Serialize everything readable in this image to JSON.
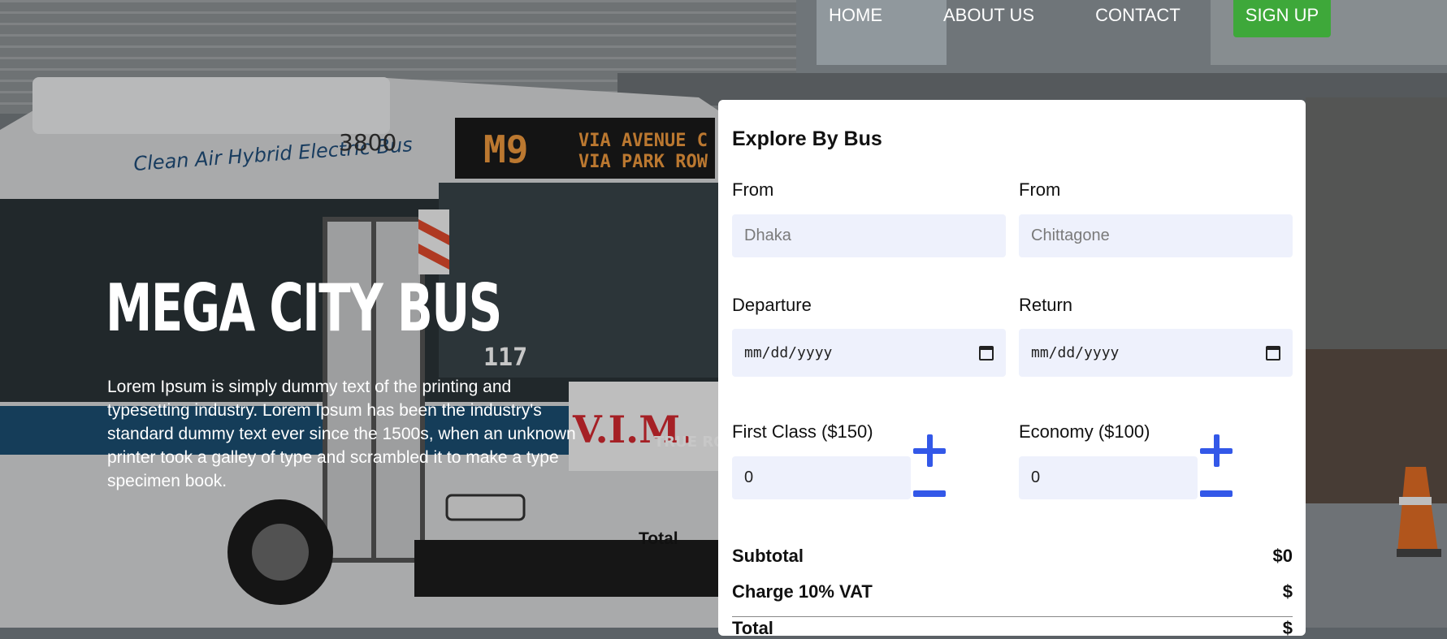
{
  "nav": {
    "items": [
      "HOME",
      "ABOUT US",
      "CONTACT"
    ],
    "signup_label": "SIGN UP"
  },
  "hero": {
    "title": "MEGA CITY BUS",
    "text": "Lorem Ipsum is simply dummy text of the printing and typesetting industry. Lorem Ipsum has been the industry's standard dummy text ever since the 1500s, when an unknown printer took a galley of type and scrambled it to make a type specimen book.",
    "stray_label": "Total"
  },
  "booking": {
    "title": "Explore By Bus",
    "from1_label": "From",
    "from1_placeholder": "Dhaka",
    "from2_label": "From",
    "from2_placeholder": "Chittagone",
    "departure_label": "Departure",
    "departure_value": "mm/dd/yyyy",
    "return_label": "Return",
    "return_value": "mm/dd/yyyy",
    "first_class_label": "First Class ($150)",
    "first_class_value": "0",
    "economy_label": "Economy ($100)",
    "economy_value": "0",
    "subtotal_label": "Subtotal",
    "subtotal_value": "$0",
    "vat_label": "Charge 10% VAT",
    "vat_value": "$",
    "total_label": "Total",
    "total_value": "$"
  },
  "photo_text": {
    "bus_side": "Clean Air Hybrid Electric Bus",
    "bus_number": "3800",
    "route": "M9",
    "via1": "VIA AVENUE C",
    "via2": "VIA PARK ROW",
    "unit": "117",
    "ad": "V.I.M.",
    "ad2": "TRUE ROCK"
  },
  "colors": {
    "accent": "#3358e8",
    "signup": "#3ea83a",
    "input_bg": "#eef1fc"
  }
}
